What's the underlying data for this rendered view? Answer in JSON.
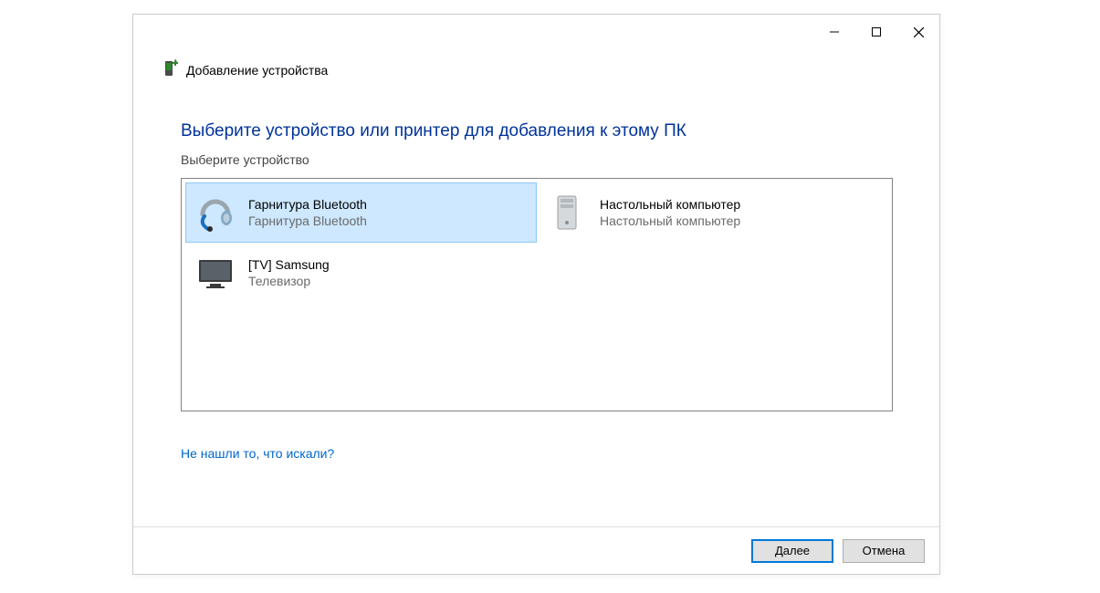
{
  "window": {
    "title": "Добавление устройства"
  },
  "content": {
    "heading": "Выберите устройство или принтер для добавления к этому ПК",
    "subheading": "Выберите устройство",
    "help_link": "Не нашли то, что искали?"
  },
  "devices": [
    {
      "name": "Гарнитура Bluetooth",
      "type": "Гарнитура Bluetooth",
      "icon": "headset",
      "selected": true
    },
    {
      "name": "Настольный компьютер",
      "type": "Настольный компьютер",
      "icon": "desktop",
      "selected": false
    },
    {
      "name": "[TV] Samsung",
      "type": "Телевизор",
      "icon": "tv",
      "selected": false
    }
  ],
  "footer": {
    "next": "Далее",
    "cancel": "Отмена"
  }
}
